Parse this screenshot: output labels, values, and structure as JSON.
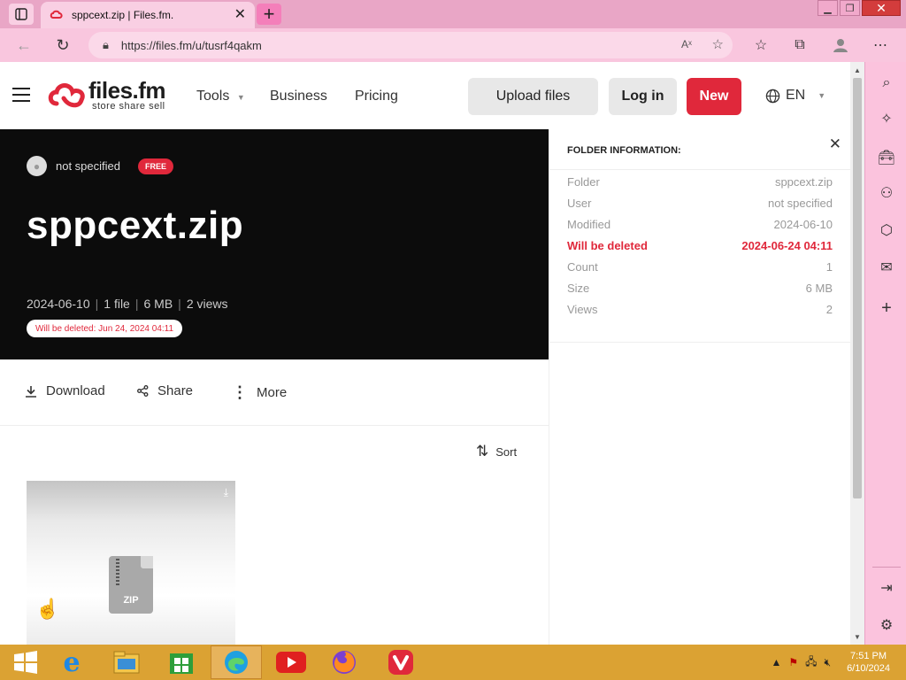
{
  "browser": {
    "tab_title": "sppcext.zip | Files.fm.",
    "url": "https://files.fm/u/tusrf4qakm",
    "read_aloud_icon": "Aˣ"
  },
  "site": {
    "brand": "files.fm",
    "tagline": "store share sell",
    "nav": [
      "Tools",
      "Business",
      "Pricing"
    ],
    "upload_label": "Upload files",
    "login_label": "Log in",
    "new_label": "New",
    "language": "EN"
  },
  "hero": {
    "owner": "not specified",
    "plan_badge": "FREE",
    "title": "sppcext.zip",
    "meta": {
      "date": "2024-06-10",
      "files": "1 file",
      "size": "6 MB",
      "views": "2 views"
    },
    "delete_notice": "Will be deleted: Jun 24, 2024 04:11"
  },
  "actions": {
    "download": "Download",
    "share": "Share",
    "more": "More",
    "sort": "Sort"
  },
  "file_card": {
    "type_label": "ZIP"
  },
  "info_panel": {
    "title": "FOLDER INFORMATION:",
    "rows": [
      {
        "label": "Folder",
        "value": "sppcext.zip"
      },
      {
        "label": "User",
        "value": "not specified"
      },
      {
        "label": "Modified",
        "value": "2024-06-10"
      },
      {
        "label": "Will be deleted",
        "value": "2024-06-24 04:11"
      },
      {
        "label": "Count",
        "value": "1"
      },
      {
        "label": "Size",
        "value": "6 MB"
      },
      {
        "label": "Views",
        "value": "2"
      }
    ]
  },
  "taskbar": {
    "time": "7:51 PM",
    "date": "6/10/2024"
  },
  "colors": {
    "brand_red": "#e0283b",
    "hero_bg": "#0c0c0c",
    "taskbar": "#dba233",
    "browser_chrome": "#f9c6de"
  }
}
